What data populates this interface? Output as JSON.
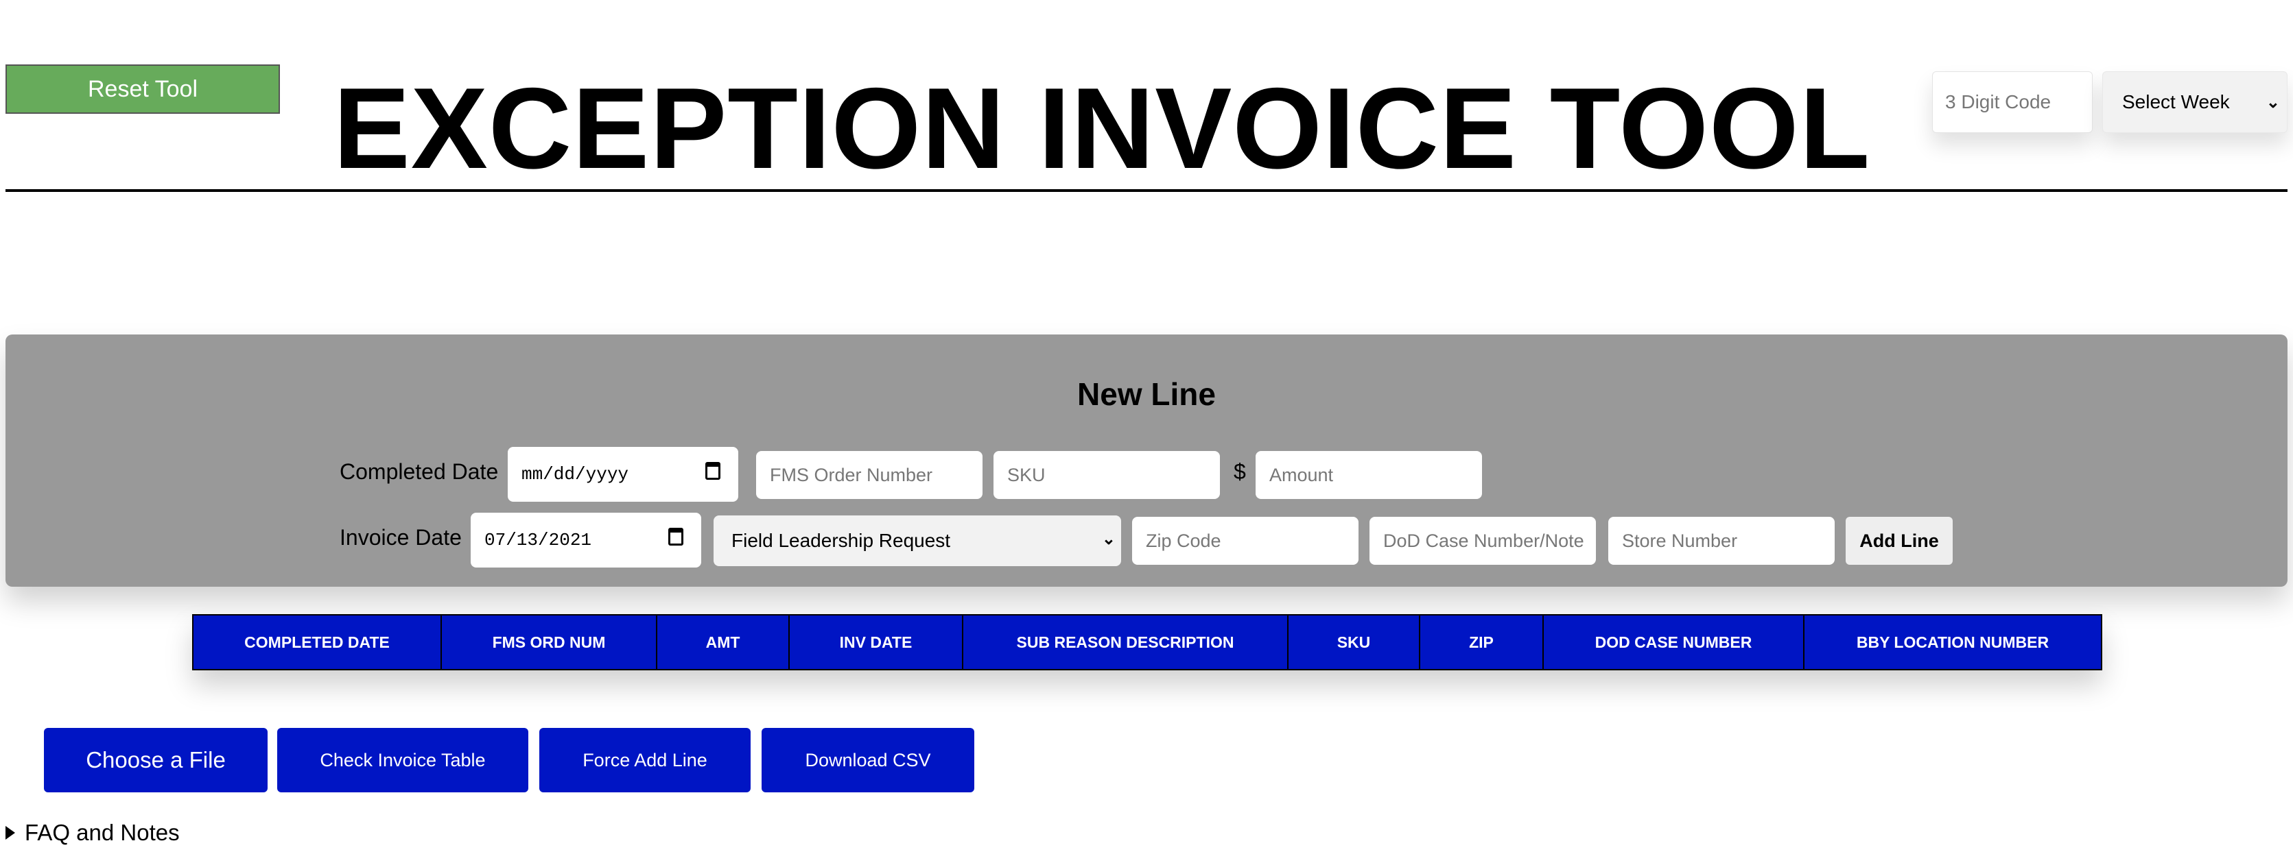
{
  "header": {
    "reset_label": "Reset Tool",
    "title": "EXCEPTION INVOICE TOOL",
    "code_placeholder": "3 Digit Code",
    "week_select_value": "Select Week"
  },
  "new_line": {
    "title": "New Line",
    "completed_date_label": "Completed Date",
    "completed_date_value": "mm/dd/yyyy",
    "fms_order_placeholder": "FMS Order Number",
    "sku_placeholder": "SKU",
    "currency_symbol": "$",
    "amount_placeholder": "Amount",
    "invoice_date_label": "Invoice Date",
    "invoice_date_value": "07/13/2021",
    "reason_select_value": "Field Leadership Request",
    "zip_placeholder": "Zip Code",
    "dod_placeholder": "DoD Case Number/Note",
    "store_placeholder": "Store Number",
    "add_line_label": "Add Line"
  },
  "table": {
    "columns": [
      "COMPLETED DATE",
      "FMS ORD NUM",
      "AMT",
      "INV DATE",
      "SUB REASON DESCRIPTION",
      "SKU",
      "ZIP",
      "DOD CASE NUMBER",
      "BBY LOCATION NUMBER"
    ]
  },
  "actions": {
    "choose_file": "Choose a File",
    "check_table": "Check Invoice Table",
    "force_add": "Force Add Line",
    "download_csv": "Download CSV"
  },
  "faq": {
    "label": "FAQ and Notes"
  },
  "colors": {
    "reset_green": "#67ab5b",
    "primary_blue": "#0015c4",
    "panel_gray": "#999999"
  }
}
